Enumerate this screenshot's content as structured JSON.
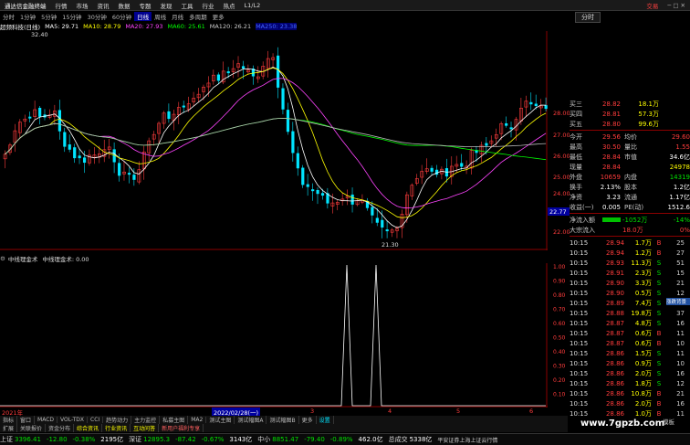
{
  "app": {
    "title": "通达信金融终端",
    "menu": [
      "行情",
      "市场",
      "资讯",
      "数据",
      "专题",
      "发现",
      "工具",
      "行业",
      "热点",
      "L1/L2"
    ],
    "right_label": "交易"
  },
  "timeframes": [
    "分时",
    "1分钟",
    "5分钟",
    "15分钟",
    "30分钟",
    "60分钟",
    "日线",
    "周线",
    "月线",
    "多周期",
    "更多"
  ],
  "active_timeframe": "日线",
  "stock": {
    "name": "超频科技(日线)"
  },
  "ma": [
    {
      "label": "MA5: 29.71",
      "color": "#ffffff"
    },
    {
      "label": "MA10: 28.79",
      "color": "#ffff00"
    },
    {
      "label": "MA20: 27.93",
      "color": "#ff44ff"
    },
    {
      "label": "MA60: 25.61",
      "color": "#00ff00"
    },
    {
      "label": "MA120: 26.21",
      "color": "#cccccc"
    },
    {
      "label": "MA250: 23.38",
      "color": "#4466ff"
    }
  ],
  "price_labels": {
    "high": "32.40",
    "low": "21.30"
  },
  "price_axis": [
    "28.00",
    "27.00",
    "26.00",
    "25.00",
    "24.00",
    "23.00",
    "22.00"
  ],
  "current_price_tag": "22.77",
  "indicator": {
    "title": "中线理金术",
    "line": "中线理金术: 0.00",
    "axis": [
      "1.00",
      "0.90",
      "0.80",
      "0.70",
      "0.60",
      "0.50",
      "0.40",
      "0.30",
      "0.20",
      "0.10"
    ]
  },
  "date_axis": {
    "start": "2021年",
    "marker": "2022/02/28(一)",
    "ticks": [
      "3",
      "4",
      "5",
      "6"
    ]
  },
  "bottom_tabs": [
    "指标",
    "窗口",
    "MACD",
    "VOL-TDX",
    "CCI",
    "趋势动力",
    "主力监控",
    "私募主图",
    "MA2",
    "测试主图",
    "测试幅图A",
    "测试幅图B",
    "更多",
    "设置"
  ],
  "sub_tabs": [
    "扩展",
    "关联报价",
    "资金分布",
    "综合资讯",
    "行业资讯",
    "互动问答",
    "新用户福利专享"
  ],
  "quote": {
    "rows": [
      {
        "l": "买三",
        "v1": "28.82",
        "v2": "18.1万"
      },
      {
        "l": "买四",
        "v1": "28.81",
        "v2": "57.3万"
      },
      {
        "l": "买五",
        "v1": "28.80",
        "v2": "99.6万"
      }
    ],
    "stats": [
      {
        "l": "今开",
        "v1": "29.56",
        "l2": "均价",
        "v2": "29.60"
      },
      {
        "l": "最高",
        "v1": "30.50",
        "l2": "量比",
        "v2": "1.55"
      },
      {
        "l": "最低",
        "v1": "28.84",
        "l2": "市值",
        "v2": "34.6亿"
      },
      {
        "l": "现量",
        "v1": "28.84",
        "l2": "",
        "v2": "24978"
      },
      {
        "l": "外盘",
        "v1": "10659",
        "l2": "内盘",
        "v2": "14319"
      },
      {
        "l": "换手",
        "v1": "2.13%",
        "l2": "股本",
        "v2": "1.2亿"
      },
      {
        "l": "净资",
        "v1": "3.23",
        "l2": "流通",
        "v2": "1.17亿"
      },
      {
        "l": "收益(一)",
        "v1": "0.005",
        "l2": "PE(动)",
        "v2": "1512.6"
      }
    ],
    "flow": [
      {
        "l": "净流入额",
        "v": "-1052万",
        "p": "-14%"
      },
      {
        "l": "大宗流入",
        "v": "18.0万",
        "p": "0%"
      }
    ]
  },
  "ticks": [
    {
      "t": "10:15",
      "p": "28.94",
      "vol": "1.7万",
      "bs": "B",
      "n": "25"
    },
    {
      "t": "10:15",
      "p": "28.94",
      "vol": "1.2万",
      "bs": "B",
      "n": "27"
    },
    {
      "t": "10:15",
      "p": "28.93",
      "vol": "11.3万",
      "bs": "S",
      "n": "51"
    },
    {
      "t": "10:15",
      "p": "28.91",
      "vol": "2.3万",
      "bs": "S",
      "n": "15"
    },
    {
      "t": "10:15",
      "p": "28.90",
      "vol": "3.3万",
      "bs": "S",
      "n": "21"
    },
    {
      "t": "10:15",
      "p": "28.90",
      "vol": "0.5万",
      "bs": "S",
      "n": "12"
    },
    {
      "t": "10:15",
      "p": "28.89",
      "vol": "7.4万",
      "bs": "S",
      "n": "34"
    },
    {
      "t": "10:15",
      "p": "28.88",
      "vol": "19.8万",
      "bs": "S",
      "n": "37"
    },
    {
      "t": "10:15",
      "p": "28.87",
      "vol": "4.8万",
      "bs": "S",
      "n": "16"
    },
    {
      "t": "10:15",
      "p": "28.87",
      "vol": "0.6万",
      "bs": "B",
      "n": "11"
    },
    {
      "t": "10:15",
      "p": "28.87",
      "vol": "0.6万",
      "bs": "B",
      "n": "10"
    },
    {
      "t": "10:15",
      "p": "28.86",
      "vol": "1.5万",
      "bs": "S",
      "n": "11"
    },
    {
      "t": "10:15",
      "p": "28.86",
      "vol": "0.9万",
      "bs": "S",
      "n": "10"
    },
    {
      "t": "10:15",
      "p": "28.86",
      "vol": "2.0万",
      "bs": "S",
      "n": "16"
    },
    {
      "t": "10:15",
      "p": "28.86",
      "vol": "1.8万",
      "bs": "S",
      "n": "12"
    },
    {
      "t": "10:15",
      "p": "28.86",
      "vol": "10.8万",
      "bs": "B",
      "n": "21"
    },
    {
      "t": "10:15",
      "p": "28.86",
      "vol": "2.0万",
      "bs": "B",
      "n": "16"
    },
    {
      "t": "10:15",
      "p": "28.86",
      "vol": "1.0万",
      "bs": "B",
      "n": "11"
    }
  ],
  "status": [
    {
      "name": "上证",
      "v": "3396.41",
      "chg": "-12.80",
      "pct": "-0.38%",
      "amt": "2195亿"
    },
    {
      "name": "深证",
      "v": "12895.3",
      "chg": "-87.42",
      "pct": "-0.67%",
      "amt": "3143亿"
    },
    {
      "name": "中小",
      "v": "8851.47",
      "chg": "-79.40",
      "pct": "-0.89%",
      "amt": "462.0亿"
    }
  ],
  "status_extra": {
    "total_label": "总成交",
    "total": "5338亿",
    "broker": "平安证券上海上证云行情"
  },
  "watermark": "www.7gpzb.com",
  "right_tabs": {
    "fen": "分时",
    "indicator_tab": "涨跌背景",
    "bottom": "模板"
  },
  "tick_header": "逐笔成交"
}
